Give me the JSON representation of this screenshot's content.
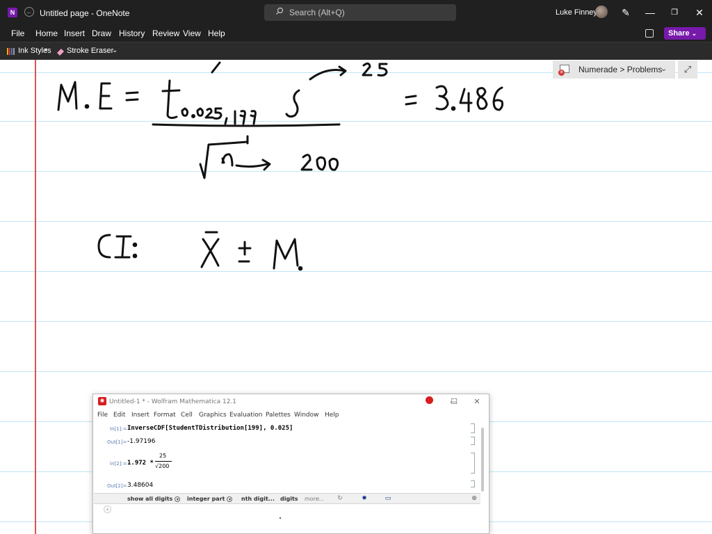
{
  "window": {
    "app_icon": "onenote-icon",
    "title": "Untitled page  -  OneNote",
    "search_placeholder": "Search (Alt+Q)",
    "user_name": "Luke Finney"
  },
  "menu": {
    "items": [
      "File",
      "Home",
      "Insert",
      "Draw",
      "History",
      "Review",
      "View",
      "Help"
    ],
    "share_label": "Share"
  },
  "ribbon": {
    "ink_styles": "Ink Styles",
    "stroke_eraser": "Stroke Eraser"
  },
  "breadcrumb": {
    "text": "Numerade > Problems"
  },
  "handwriting": {
    "line1": "M.E = t0.025,199 s / √n = 3.486",
    "s_value": "25",
    "n_value": "200",
    "result": "= 3.486",
    "line2": "CI:  x̄ ± M."
  },
  "mathematica": {
    "title": "Untitled-1 * - Wolfram Mathematica 12.1",
    "menu": [
      "File",
      "Edit",
      "Insert",
      "Format",
      "Cell",
      "Graphics",
      "Evaluation",
      "Palettes",
      "Window",
      "Help"
    ],
    "cells": [
      {
        "in_label": "In[1]:=",
        "input": "InverseCDF[StudentTDistribution[199], 0.025]",
        "out_label": "Out[1]=",
        "output": "-1.97196"
      },
      {
        "in_label": "In[2]:=",
        "input_prefix": "1.972 *",
        "numerator": "25",
        "denominator": "√200",
        "out_label": "Out[2]=",
        "output": "3.48604"
      }
    ],
    "suggestion_bar": {
      "items": [
        "show all digits",
        "integer part",
        "nth digit...",
        "digits",
        "more..."
      ]
    }
  },
  "colors": {
    "title_bg": "#202020",
    "accent": "#7719aa",
    "rule_line": "#bfe6f7",
    "margin_line": "#e05050",
    "mathematica_red": "#d81e1e"
  }
}
